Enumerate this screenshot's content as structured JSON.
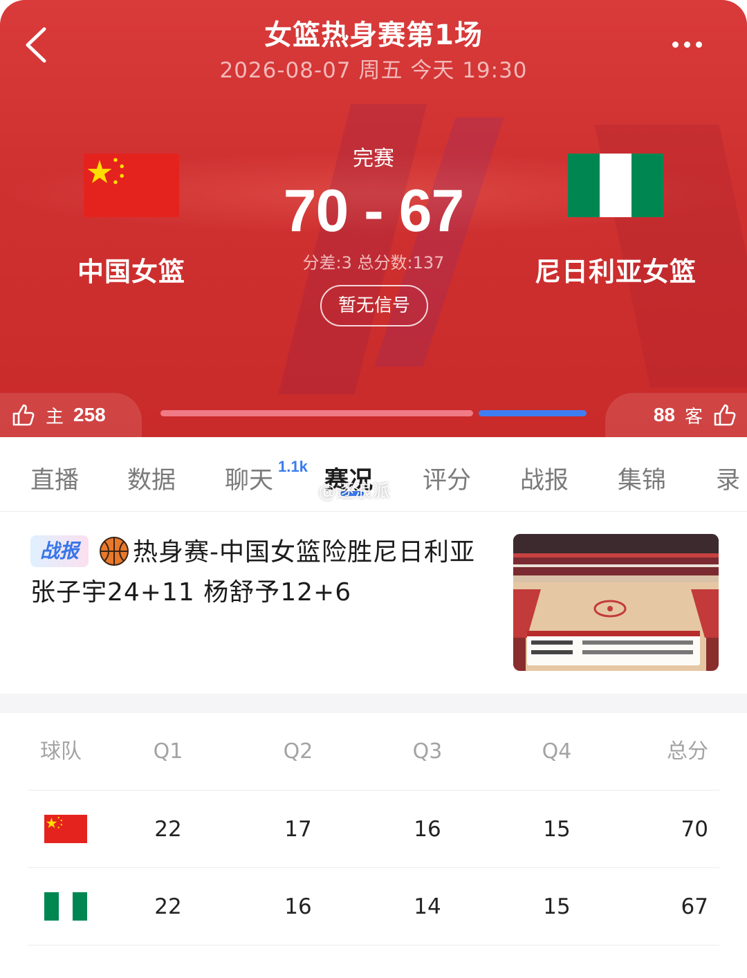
{
  "header": {
    "title": "女篮热身赛第1场",
    "subtitle": "2026-08-07 周五 今天 19:30"
  },
  "match": {
    "status": "完赛",
    "score": "70 - 67",
    "diff_info": "分差:3 总分数:137",
    "signal_label": "暂无信号",
    "home": {
      "name": "中国女篮",
      "flag": "china-flag"
    },
    "away": {
      "name": "尼日利亚女篮",
      "flag": "nigeria-flag"
    }
  },
  "support": {
    "home_label": "主",
    "home_count": "258",
    "away_label": "客",
    "away_count": "88",
    "home_color": "#f07a86",
    "away_color": "#3f7ef2"
  },
  "tabs": [
    {
      "label": "直播"
    },
    {
      "label": "数据"
    },
    {
      "label": "聊天",
      "badge": "1.1k"
    },
    {
      "label": "赛况",
      "active": true
    },
    {
      "label": "评分"
    },
    {
      "label": "战报"
    },
    {
      "label": "集锦"
    },
    {
      "label": "录"
    }
  ],
  "watermark": "@逐浪派",
  "news": {
    "badge": "战报",
    "title": "热身赛-中国女篮险胜尼日利亚 张子宇24+11 杨舒予12+6",
    "thumbnail": "basketball-court-photo"
  },
  "scoreboard": {
    "headers": [
      "球队",
      "Q1",
      "Q2",
      "Q3",
      "Q4",
      "总分"
    ],
    "rows": [
      {
        "team": "china-flag",
        "q1": "22",
        "q2": "17",
        "q3": "16",
        "q4": "15",
        "total": "70"
      },
      {
        "team": "nigeria-flag",
        "q1": "22",
        "q2": "16",
        "q3": "14",
        "q4": "15",
        "total": "67"
      }
    ]
  },
  "colors": {
    "hero_red": "#d93a3a",
    "accent_blue": "#3a7bf0",
    "china_red": "#e5231e",
    "china_star": "#ffde00",
    "nigeria_green": "#008751"
  }
}
